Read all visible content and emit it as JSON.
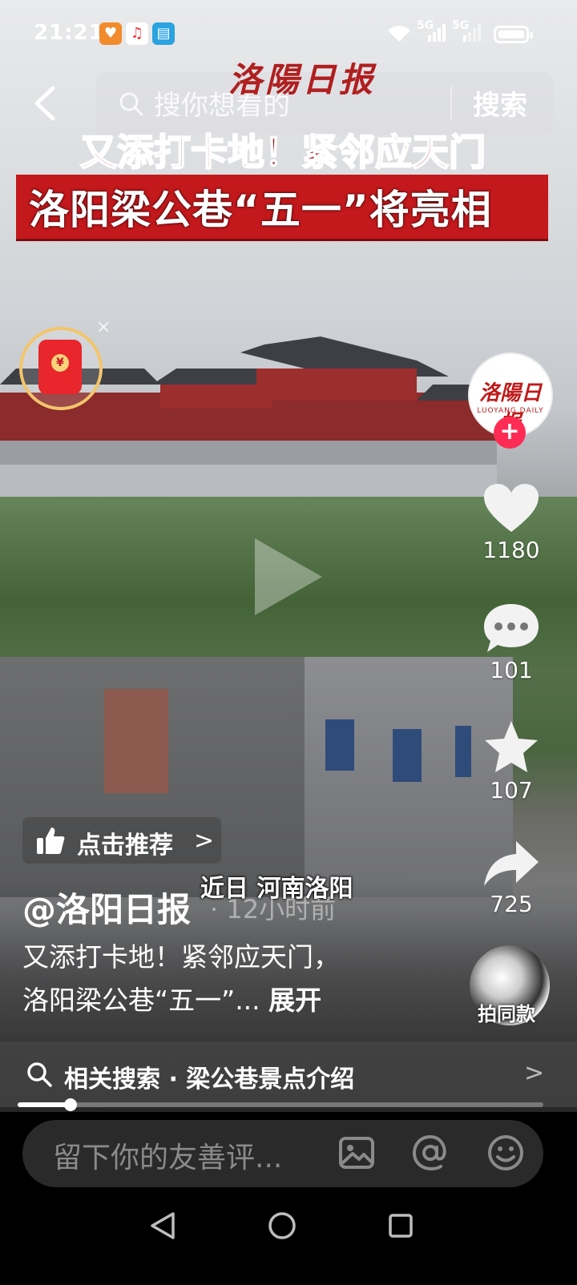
{
  "status_bar": {
    "time": "21:21",
    "network_1": "5G",
    "network_2": "5G",
    "app_icons": [
      "heart-app-icon",
      "music-app-icon",
      "book-app-icon"
    ]
  },
  "search": {
    "placeholder": "搜你想看的",
    "button": "搜索"
  },
  "video": {
    "watermark": "洛陽日报",
    "headline_line1": "又添打卡地！紧邻应天门",
    "headline_line2": "洛阳梁公巷“五一”将亮相",
    "subtitle": "近日 河南洛阳",
    "progress_fraction": 0.1
  },
  "creator": {
    "avatar_logo": "洛陽日报",
    "avatar_logo_sub": "LUOYANG DAILY",
    "follow_symbol": "+"
  },
  "actions": {
    "likes": "1180",
    "comments": "101",
    "favorites": "107",
    "shares": "725"
  },
  "recommend": {
    "label": "点击推荐",
    "chevron": ">"
  },
  "post": {
    "author": "@洛阳日报",
    "time_ago": "· 12小时前",
    "description_line1": "又添打卡地！紧邻应天门，",
    "description_line2": "洛阳梁公巷“五一”...",
    "expand": "展开"
  },
  "same_style": {
    "label": "拍同款"
  },
  "related_search": {
    "text": "相关搜索 · 梁公巷景点介绍",
    "chevron": ">"
  },
  "comment_bar": {
    "placeholder": "留下你的友善评..."
  },
  "red_packet": {
    "close": "×",
    "symbol": "¥"
  }
}
